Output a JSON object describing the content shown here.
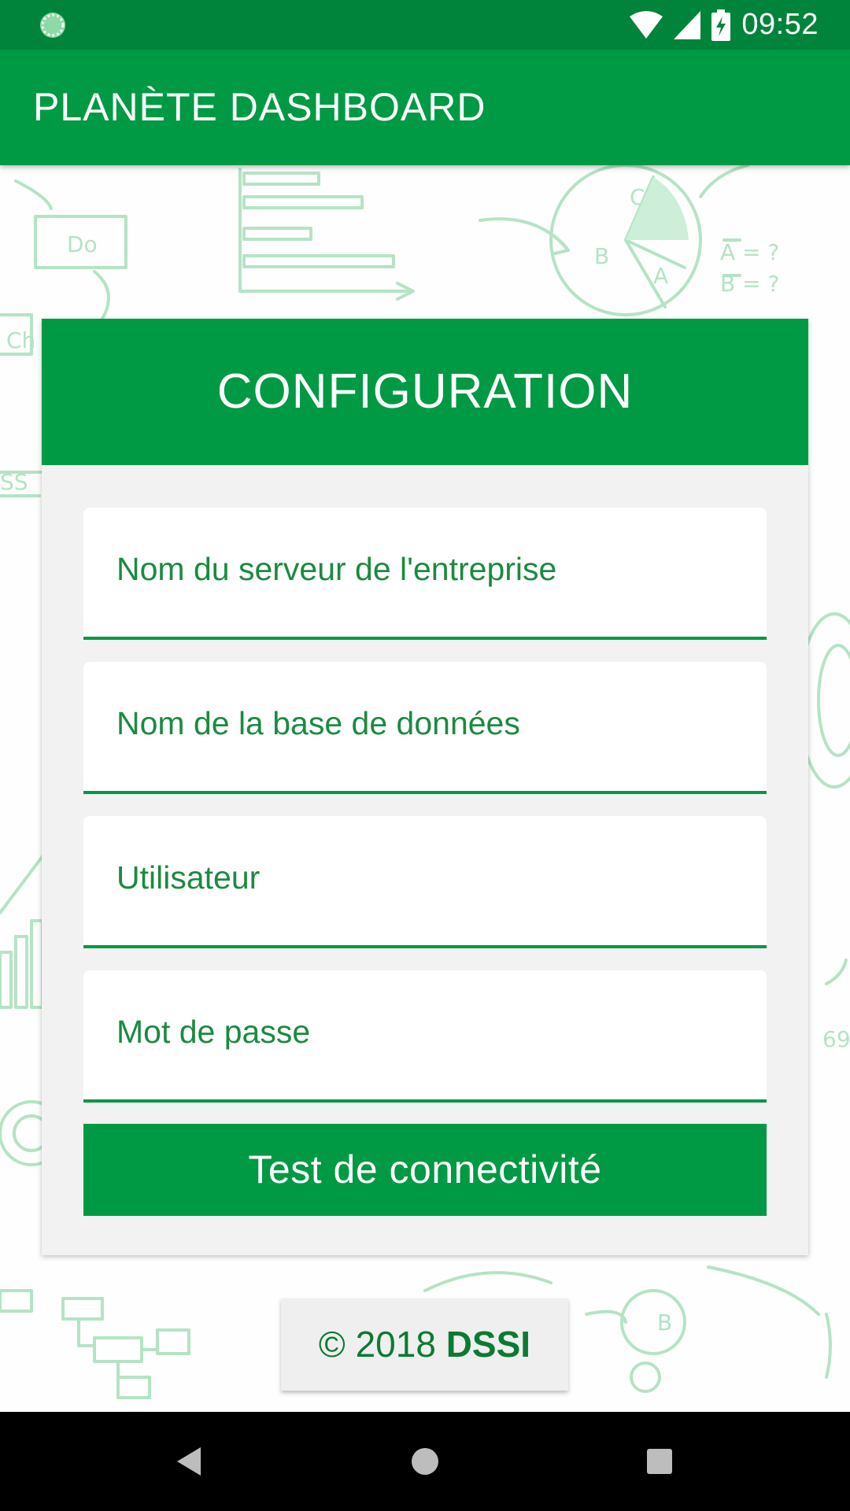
{
  "status_bar": {
    "time": "09:52",
    "left_icon": "loading-circle-icon",
    "icons": [
      "wifi-icon",
      "cell-signal-icon",
      "battery-charging-icon"
    ]
  },
  "app_bar": {
    "title": "PLANÈTE DASHBOARD"
  },
  "card": {
    "title": "CONFIGURATION",
    "fields": [
      {
        "placeholder": "Nom du serveur de l'entreprise",
        "value": ""
      },
      {
        "placeholder": "Nom de la base de données",
        "value": ""
      },
      {
        "placeholder": "Utilisateur",
        "value": ""
      },
      {
        "placeholder": "Mot de passe",
        "value": ""
      }
    ],
    "button_label": "Test de connectivité"
  },
  "footer": {
    "copyright": "© 2018",
    "brand": "DSSI"
  },
  "nav_bar": {
    "buttons": [
      "back-icon",
      "home-icon",
      "recents-icon"
    ]
  },
  "colors": {
    "primary": "#009944",
    "status_bar": "#00843b",
    "field_text": "#1c8a40",
    "card_bg": "#f2f2f2"
  }
}
